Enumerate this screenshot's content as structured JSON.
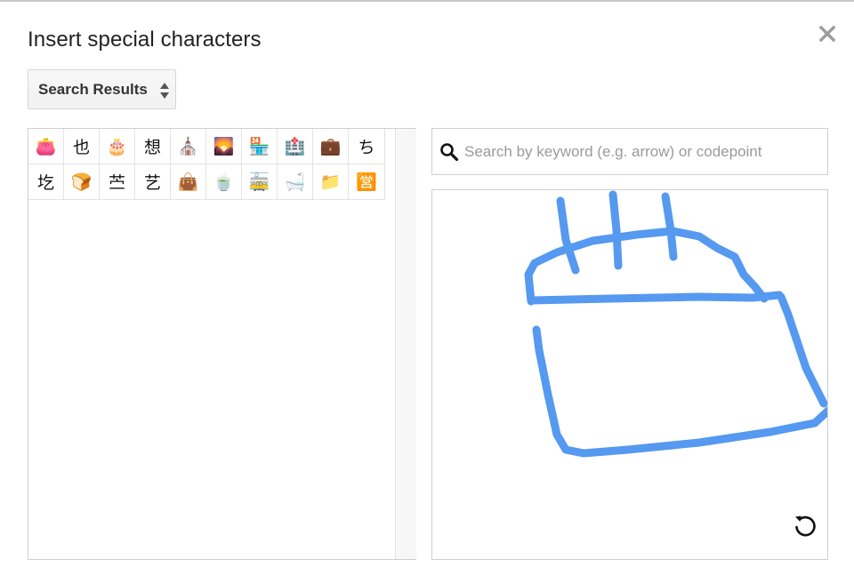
{
  "dialog": {
    "title": "Insert special characters"
  },
  "category_dropdown": {
    "selected": "Search Results"
  },
  "results": {
    "characters": [
      "👛",
      "也",
      "🎂",
      "想",
      "⛪",
      "🌄",
      "🏪",
      "🏥",
      "💼",
      "ち",
      "圪",
      "🍞",
      "苎",
      "艺",
      "👜",
      "🍵",
      "🚋",
      "🛁",
      "📁",
      "🈺"
    ]
  },
  "search": {
    "placeholder": "Search by keyword (e.g. arrow) or codepoint",
    "value": ""
  },
  "drawing": {
    "stroke_color": "#5599f0"
  },
  "icons": {
    "close": "close-icon",
    "dropdown": "up-down-arrows-icon",
    "search": "search-icon",
    "reset": "undo-reset-icon"
  }
}
